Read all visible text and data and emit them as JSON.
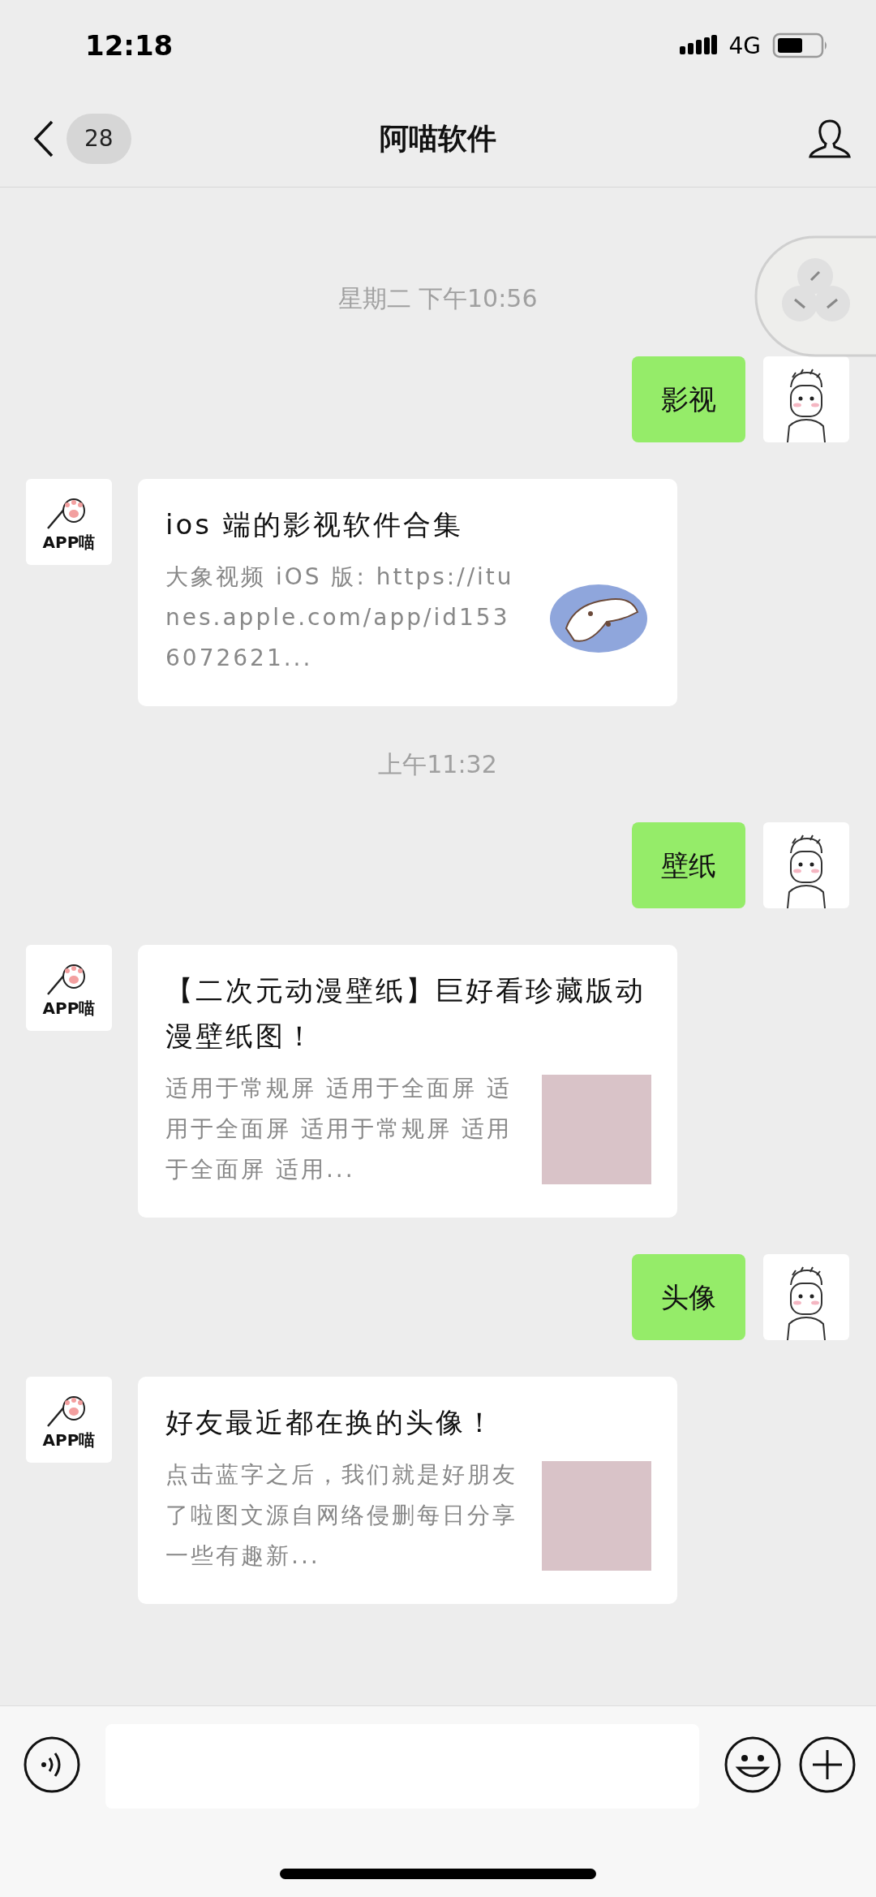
{
  "status_bar": {
    "time": "12:18",
    "network": "4G"
  },
  "nav": {
    "unread_count": "28",
    "title": "阿喵软件"
  },
  "messages": [
    {
      "kind": "timestamp",
      "text": "星期二 下午10:56"
    },
    {
      "kind": "text",
      "text": "影视"
    },
    {
      "kind": "article",
      "avatar_label": "APP喵",
      "title": "ios 端的影视软件合集",
      "description": "大象视频 iOS 版: https://itunes.apple.com/app/id1536072621...",
      "thumbnail": {
        "kind": "cartoon"
      }
    },
    {
      "kind": "timestamp",
      "text": "上午11:32"
    },
    {
      "kind": "text",
      "text": "壁纸"
    },
    {
      "kind": "article",
      "avatar_label": "APP喵",
      "title": "【二次元动漫壁纸】巨好看珍藏版动漫壁纸图！",
      "description": "适用于常规屏 适用于全面屏 适用于全面屏 适用于常规屏 适用于全面屏 适用...",
      "thumbnail": {
        "kind": "photo"
      }
    },
    {
      "kind": "text",
      "text": "头像"
    },
    {
      "kind": "article",
      "avatar_label": "APP喵",
      "title": "好友最近都在换的头像！",
      "description": "点击蓝字之后，我们就是好朋友了啦图文源自网络侵删每日分享一些有趣新...",
      "thumbnail": {
        "kind": "photo"
      }
    }
  ]
}
